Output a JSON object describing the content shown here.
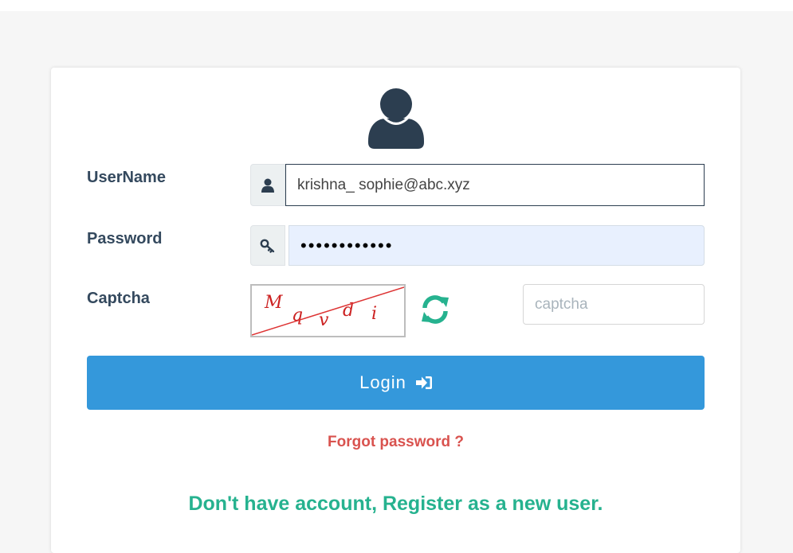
{
  "form": {
    "username_label": "UserName",
    "username_value": "krishna_ sophie@abc.xyz",
    "password_label": "Password",
    "password_value": "••••••••••••",
    "captcha_label": "Captcha",
    "captcha_chars": [
      "M",
      "q",
      "v",
      "d",
      "i"
    ],
    "captcha_placeholder": "captcha",
    "login_label": "Login",
    "forgot_label": "Forgot password ?",
    "register_label": "Don't have account, Register as a new user."
  },
  "icons": {
    "avatar": "user-icon",
    "username_addon": "user-icon",
    "password_addon": "key-icon",
    "refresh": "refresh-icon",
    "login": "sign-in-icon"
  },
  "colors": {
    "primary": "#3498db",
    "danger": "#d9534f",
    "success": "#26b28f",
    "dark": "#2c3e50"
  }
}
